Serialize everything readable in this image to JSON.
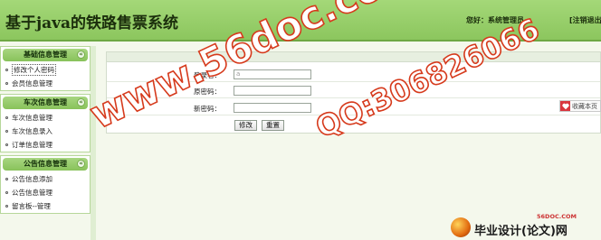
{
  "header": {
    "title": "基于java的铁路售票系统",
    "user_info": "您好：系统管理员",
    "logout": "[注销退出]"
  },
  "sidebar": {
    "groups": [
      {
        "title": "基础信息管理",
        "items": [
          {
            "label": "修改个人密码"
          },
          {
            "label": "会员信息管理"
          }
        ]
      },
      {
        "title": "车次信息管理",
        "items": [
          {
            "label": "车次信息管理"
          },
          {
            "label": "车次信息录入"
          },
          {
            "label": "订单信息管理"
          }
        ]
      },
      {
        "title": "公告信息管理",
        "items": [
          {
            "label": "公告信息添加"
          },
          {
            "label": "公告信息管理"
          },
          {
            "label": "留言板--管理"
          }
        ]
      }
    ],
    "collapse_glyph": "«"
  },
  "form": {
    "login_label": "登录名：",
    "login_value": "a",
    "old_password_label": "原密码：",
    "new_password_label": "新密码：",
    "submit_label": "修改",
    "reset_label": "重置"
  },
  "favorite": {
    "label": "收藏本页",
    "icon": "heart-icon"
  },
  "watermark": {
    "site": "www.56doc.com",
    "qq": "QQ:306826066"
  },
  "footer": {
    "domain": "56DOC.COM",
    "text": "毕业设计(论文)网"
  },
  "colors": {
    "header_green": "#8cc65e",
    "watermark_red": "#d63a1c",
    "heart_red": "#d9363e"
  }
}
